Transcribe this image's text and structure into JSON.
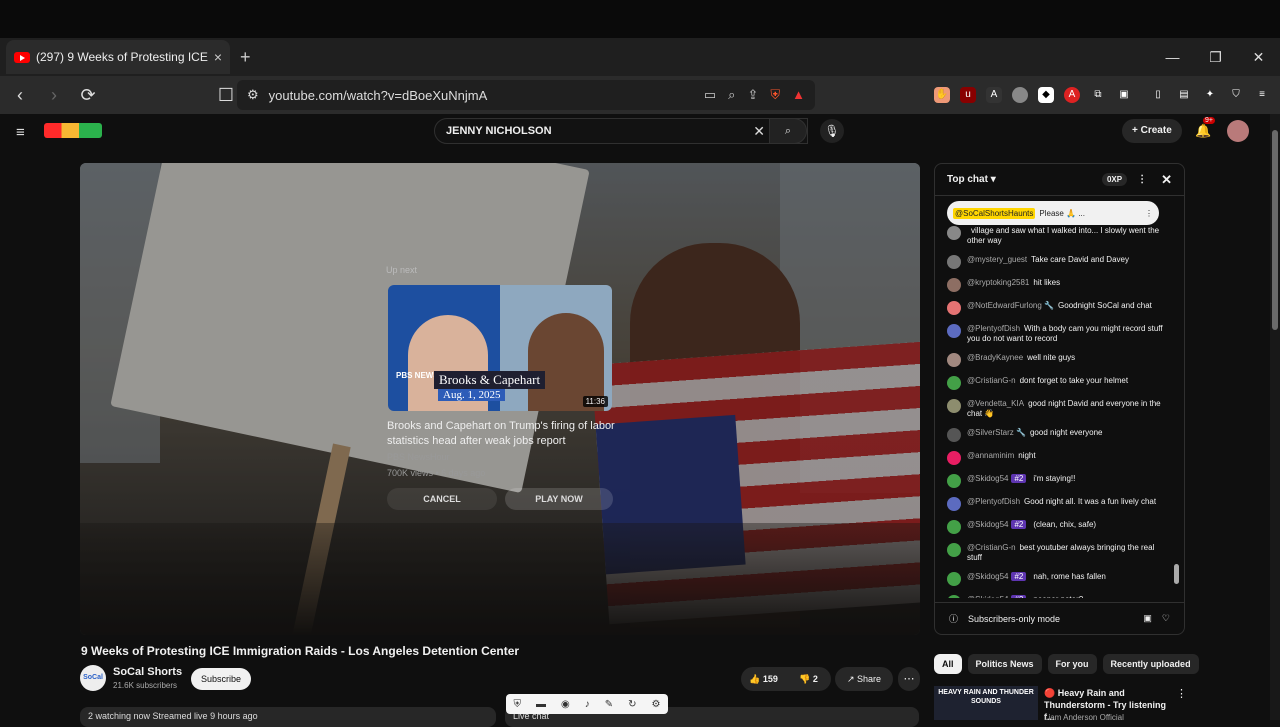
{
  "browser": {
    "tab_title": "(297) 9 Weeks of Protesting ICE I",
    "tab_close": "×",
    "new_tab": "+",
    "url": "youtube.com/watch?v=dBoeXuNnjmA",
    "window_controls": [
      "—",
      "❐",
      "✕"
    ]
  },
  "yt_header": {
    "search_value": "JENNY NICHOLSON",
    "create_label": "Create",
    "notif_count": "9+"
  },
  "player": {
    "up_next_label": "Up next",
    "next_title": "Brooks and Capehart on Trump's firing of labor statistics head after weak jobs report",
    "next_channel": "PBS NewsHour",
    "next_stats": "700K views • 6 days ago",
    "next_duration": "11:36",
    "thumb_caption": "Brooks & Capehart",
    "thumb_date": "Aug. 1, 2025",
    "thumb_brand": "PBS NEWS HOUR",
    "cancel_label": "CANCEL",
    "play_now_label": "PLAY NOW",
    "sign_text": "PROTESTING IS NOT A CRIME"
  },
  "video": {
    "title": "9 Weeks of Protesting ICE Immigration Raids - Los Angeles Detention Center",
    "channel": "SoCal Shorts",
    "channel_avatar_text": "SoCal",
    "subscribers": "21.6K subscribers",
    "subscribe_label": "Subscribe",
    "likes": "159",
    "dislikes": "2",
    "share_label": "Share",
    "description_preview": "2 watching now  Streamed live 9 hours ago",
    "live_chat_label": "Live chat"
  },
  "chat": {
    "header_label": "Top chat",
    "xp_label": "0XP",
    "pinned_name": "@SoCalShortsHaunts",
    "pinned_text": "Please 🙏 ...",
    "messages": [
      {
        "name": "",
        "badge": "",
        "text": "village and saw what I walked into... I slowly went the other way",
        "color": "#888"
      },
      {
        "name": "@mystery_guest",
        "badge": "",
        "text": "Take care David and Davey",
        "color": "#777"
      },
      {
        "name": "@kryptoking2581",
        "badge": "",
        "text": "hit likes",
        "color": "#8d6e63"
      },
      {
        "name": "@NotEdwardFurlong 🔧",
        "badge": "",
        "text": "Goodnight SoCal and chat",
        "color": "#e57373"
      },
      {
        "name": "@PlentyofDish",
        "badge": "",
        "text": "With a body cam you might record stuff you do not want to record",
        "color": "#5c6bc0"
      },
      {
        "name": "@BradyKaynee",
        "badge": "",
        "text": "well nite guys",
        "color": "#a1887f"
      },
      {
        "name": "@CristianG-n",
        "badge": "",
        "text": "dont forget to take your helmet",
        "color": "#43a047"
      },
      {
        "name": "@Vendetta_KIA",
        "badge": "",
        "text": "good night David and everyone in the chat 👋",
        "color": "#8d8d6e"
      },
      {
        "name": "@SilverStarz 🔧",
        "badge": "",
        "text": "good night everyone",
        "color": "#555"
      },
      {
        "name": "@annaminim",
        "badge": "",
        "text": "night",
        "color": "#e91e63"
      },
      {
        "name": "@Skidog54",
        "badge": "#2",
        "text": "i'm staying!!",
        "color": "#43a047"
      },
      {
        "name": "@PlentyofDish",
        "badge": "",
        "text": "Good night all. It was a fun lively chat",
        "color": "#5c6bc0"
      },
      {
        "name": "@Skidog54",
        "badge": "#2",
        "text": "(clean, chix, safe)",
        "color": "#43a047"
      },
      {
        "name": "@CristianG-n",
        "badge": "",
        "text": "best youtuber always bringing the real stuff",
        "color": "#43a047"
      },
      {
        "name": "@Skidog54",
        "badge": "#2",
        "text": "nah, rome has fallen",
        "color": "#43a047"
      },
      {
        "name": "@Skidog54",
        "badge": "#2",
        "text": "peeper peter?",
        "color": "#43a047"
      },
      {
        "name": "@Skidog54",
        "badge": "#2",
        "text": "peeper! mystery!",
        "color": "#43a047"
      }
    ],
    "footer_label": "Subscribers-only mode"
  },
  "chips": [
    "All",
    "Politics News",
    "For you",
    "Recently uploaded"
  ],
  "recommendation": {
    "thumb_text": "HEAVY RAIN AND THUNDER SOUNDS",
    "title": "🔴 Heavy Rain and Thunderstorm - Try listening f...",
    "channel": "Liam Anderson Official"
  }
}
